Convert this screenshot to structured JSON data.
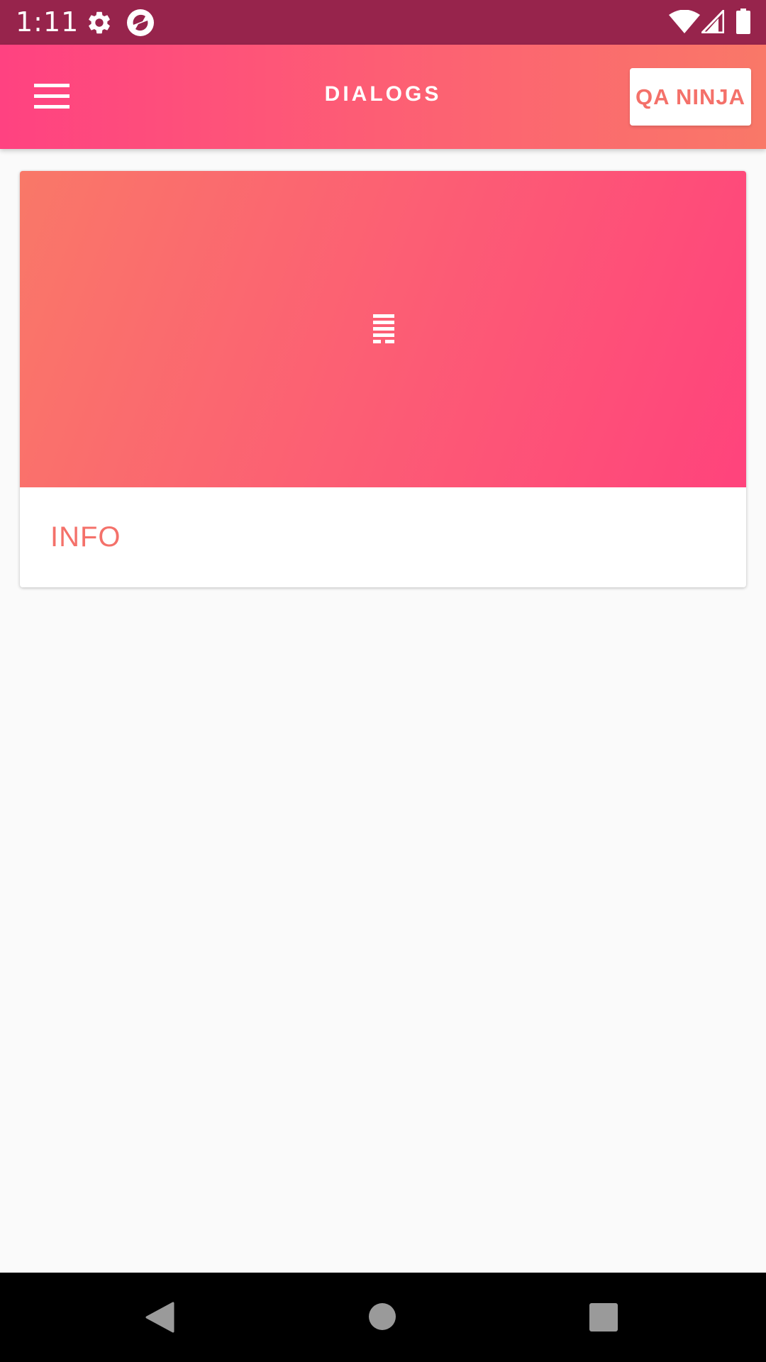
{
  "status_bar": {
    "time": "1:11",
    "icons": [
      "settings-icon",
      "sync-app-icon",
      "wifi-icon",
      "signal-icon",
      "battery-icon"
    ],
    "color": "#97244c"
  },
  "app_bar": {
    "title": "DIALOGS",
    "menu_icon": "hamburger-menu-icon",
    "action_button_label": "QA NINJA",
    "gradient": [
      "#ff4281",
      "#f97868"
    ]
  },
  "card": {
    "media_icon": "notes-lines-icon",
    "label": "INFO",
    "accent_color": "#f4716a"
  },
  "nav_bar": {
    "buttons": [
      "back-icon",
      "home-icon",
      "recents-icon"
    ]
  }
}
